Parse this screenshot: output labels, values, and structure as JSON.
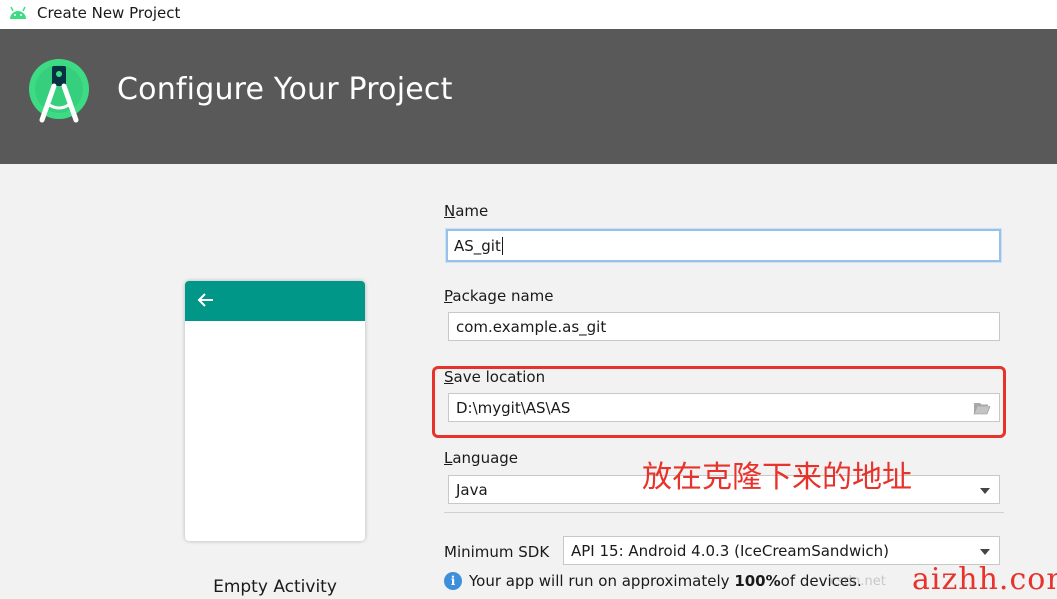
{
  "window": {
    "title": "Create New Project"
  },
  "header": {
    "title": "Configure Your Project"
  },
  "template": {
    "name": "Empty Activity"
  },
  "form": {
    "name": {
      "label_mnemonic": "N",
      "label_rest": "ame",
      "value": "AS_git"
    },
    "package": {
      "label_mnemonic": "P",
      "label_rest": "ackage name",
      "value": "com.example.as_git"
    },
    "save_location": {
      "label_mnemonic": "S",
      "label_rest": "ave location",
      "value": "D:\\mygit\\AS\\AS"
    },
    "language": {
      "label_mnemonic": "L",
      "label_rest": "anguage",
      "value": "Java"
    },
    "min_sdk": {
      "label": "Minimum SDK",
      "value": "API 15: Android 4.0.3 (IceCreamSandwich)"
    }
  },
  "info": {
    "prefix": "Your app will run on approximately ",
    "percent": "100%",
    "suffix": " of devices."
  },
  "annotation": {
    "text": "放在克隆下来的地址"
  },
  "watermark": {
    "text": "aizhh.com",
    "faint": "csdn.net"
  },
  "colors": {
    "header_bg": "#595959",
    "accent_teal": "#009688",
    "highlight_red": "#e8332c",
    "focus_blue": "#97c1e8"
  }
}
